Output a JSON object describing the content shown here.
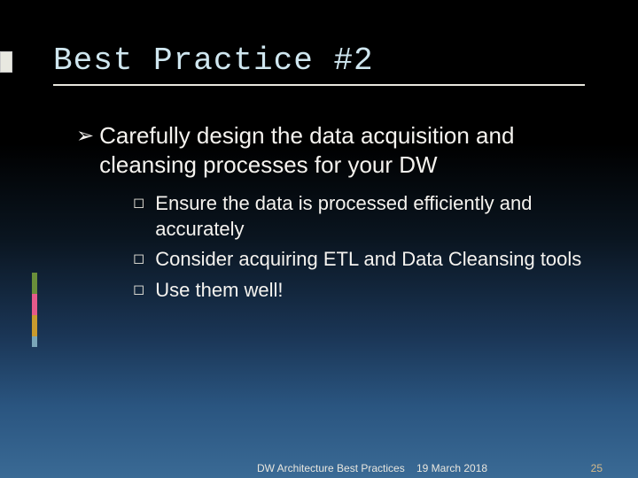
{
  "title": "Best Practice #2",
  "main_bullet": {
    "marker": "➢",
    "text": "Carefully design the data acquisition and cleansing processes for your DW"
  },
  "sub_bullets": [
    {
      "marker": "◻",
      "text": "Ensure the data is processed efficiently and accurately"
    },
    {
      "marker": "◻",
      "text": "Consider acquiring ETL and Data Cleansing tools"
    },
    {
      "marker": "◻",
      "text": "Use them well!"
    }
  ],
  "footer": {
    "source": "DW Architecture Best Practices",
    "date": "19 March 2018",
    "page": "25"
  },
  "accent_colors": [
    "#6a8f3a",
    "#e55a8a",
    "#c99b2e",
    "#7aa6b8"
  ]
}
